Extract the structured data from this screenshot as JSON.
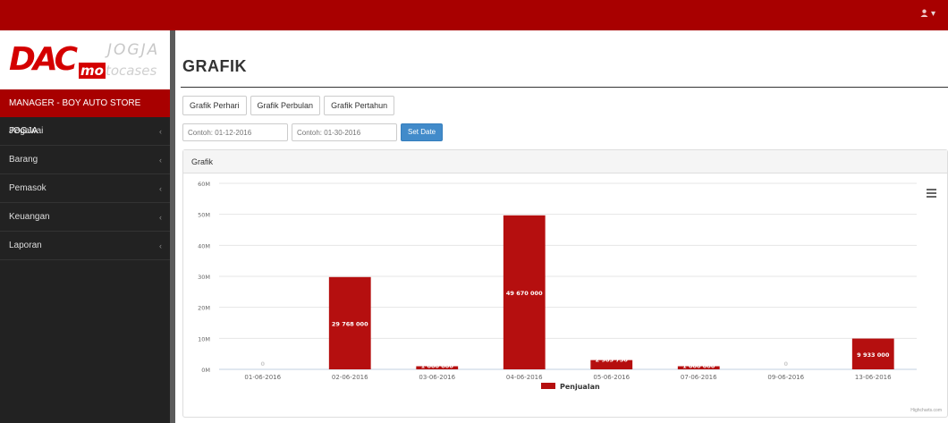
{
  "header": {
    "user_icon": "user-icon",
    "caret": "▾"
  },
  "brand": {
    "logo_main": "DAC",
    "logo_city": "JOGJA",
    "logo_sub_a": "mo",
    "logo_sub_b": "tocases"
  },
  "sidebar": {
    "role": "MANAGER - BOY AUTO STORE JOGJA",
    "items": [
      {
        "label": "Pegawai"
      },
      {
        "label": "Barang"
      },
      {
        "label": "Pemasok"
      },
      {
        "label": "Keuangan"
      },
      {
        "label": "Laporan"
      }
    ]
  },
  "main": {
    "title": "GRAFIK",
    "tabs": [
      {
        "label": "Grafik Perhari"
      },
      {
        "label": "Grafik Perbulan"
      },
      {
        "label": "Grafik Pertahun"
      }
    ],
    "date_from": {
      "placeholder": "Contoh: 01-12-2016",
      "value": ""
    },
    "date_to": {
      "placeholder": "Contoh: 01-30-2016",
      "value": ""
    },
    "set_date_label": "Set Date",
    "panel_title": "Grafik",
    "menu_icon": "hamburger-icon",
    "credits": "Highcharts.com"
  },
  "colors": {
    "brand_red": "#a80000",
    "bar": "#b50f0f",
    "sidebar": "#222222",
    "button_blue": "#428bca"
  },
  "chart_data": {
    "type": "bar",
    "categories": [
      "01-06-2016",
      "02-06-2016",
      "03-06-2016",
      "04-06-2016",
      "05-06-2016",
      "07-06-2016",
      "09-06-2016",
      "13-06-2016"
    ],
    "series": [
      {
        "name": "Penjualan",
        "values": [
          0,
          29768000,
          1000000,
          49670000,
          2983750,
          1000000,
          0,
          9933000
        ]
      }
    ],
    "data_labels": [
      "0",
      "29 768 000",
      "1 000 000",
      "49 670 000",
      "2 983 750",
      "1 000 000",
      "0",
      "9 933 000"
    ],
    "yticks": [
      "0M",
      "10M",
      "20M",
      "30M",
      "40M",
      "50M",
      "60M"
    ],
    "ylim": [
      0,
      60000000
    ],
    "grid": true,
    "legend": "bottom-center"
  }
}
